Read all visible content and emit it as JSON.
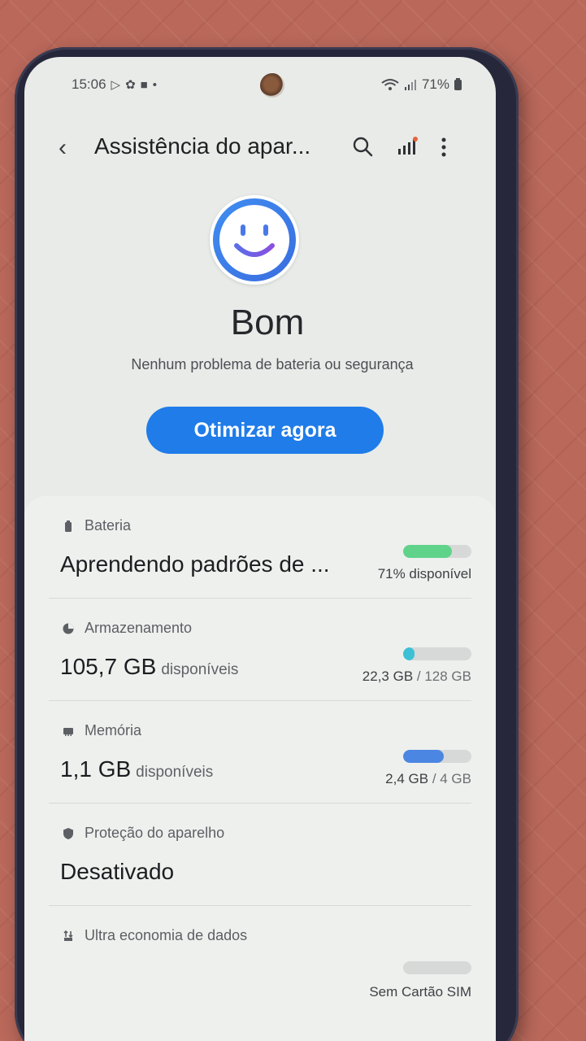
{
  "status_bar": {
    "time": "15:06",
    "battery_percent": "71%",
    "notification_icons": [
      "play-store-icon",
      "settings-icon",
      "bag-icon",
      "dot-icon"
    ]
  },
  "app_bar": {
    "title": "Assistência do apar...",
    "actions": [
      "search-icon",
      "signal-icon",
      "more-icon"
    ]
  },
  "summary": {
    "status": "Bom",
    "description": "Nenhum problema de bateria ou segurança",
    "optimize_label": "Otimizar agora"
  },
  "sections": {
    "battery": {
      "label": "Bateria",
      "value": "Aprendendo padrões de ...",
      "note": "71% disponível",
      "level": 0.71,
      "color": "#5fd38a"
    },
    "storage": {
      "label": "Armazenamento",
      "value": "105,7 GB",
      "unit": "disponíveis",
      "used": "22,3 GB",
      "total": "/ 128 GB",
      "level": 0.17,
      "color": "#3cc0d6"
    },
    "memory": {
      "label": "Memória",
      "value": "1,1 GB",
      "unit": "disponíveis",
      "used": "2,4 GB",
      "total": "/ 4 GB",
      "level": 0.6,
      "color": "#4b87e2"
    },
    "protection": {
      "label": "Proteção do aparelho",
      "value": "Desativado"
    },
    "data_saver": {
      "label": "Ultra economia de dados",
      "note": "Sem Cartão SIM",
      "level": 0
    }
  }
}
